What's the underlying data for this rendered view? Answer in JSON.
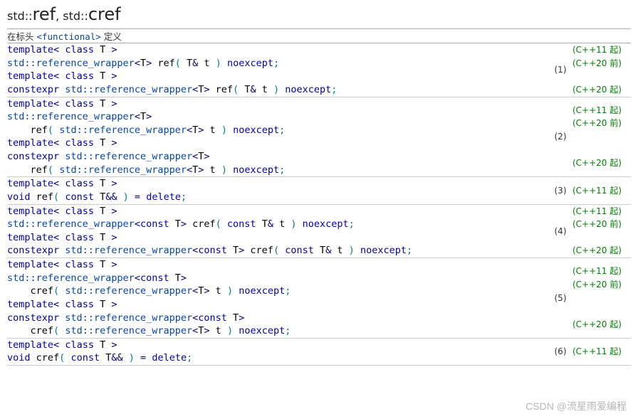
{
  "title": {
    "p1": "std::",
    "b1": "ref",
    "sep": ", ",
    "p2": "std::",
    "b2": "cref"
  },
  "header": {
    "pre": "在标头 ",
    "file": "<functional>",
    "post": " 定义"
  },
  "notes": {
    "s11": "(C++11 起)",
    "b20": "(C++20 前)",
    "s20": "(C++20 起)"
  },
  "nums": {
    "n1": "(1)",
    "n2": "(2)",
    "n3": "(3)",
    "n4": "(4)",
    "n5": "(5)",
    "n6": "(6)"
  },
  "chart_data": {
    "type": "table",
    "title": "std::ref, std::cref overloads",
    "header_note": "在标头 <functional> 定义",
    "overloads": [
      {
        "num": 1,
        "variants": [
          {
            "code": "template< class T >\nstd::reference_wrapper<T> ref( T& t ) noexcept;",
            "since": "C++11 起",
            "until": "C++20 前"
          },
          {
            "code": "template< class T >\nconstexpr std::reference_wrapper<T> ref( T& t ) noexcept;",
            "since": "C++20 起"
          }
        ]
      },
      {
        "num": 2,
        "variants": [
          {
            "code": "template< class T >\nstd::reference_wrapper<T>\n    ref( std::reference_wrapper<T> t ) noexcept;",
            "since": "C++11 起",
            "until": "C++20 前"
          },
          {
            "code": "template< class T >\nconstexpr std::reference_wrapper<T>\n    ref( std::reference_wrapper<T> t ) noexcept;",
            "since": "C++20 起"
          }
        ]
      },
      {
        "num": 3,
        "variants": [
          {
            "code": "template< class T >\nvoid ref( const T&& ) = delete;",
            "since": "C++11 起"
          }
        ]
      },
      {
        "num": 4,
        "variants": [
          {
            "code": "template< class T >\nstd::reference_wrapper<const T> cref( const T& t ) noexcept;",
            "since": "C++11 起",
            "until": "C++20 前"
          },
          {
            "code": "template< class T >\nconstexpr std::reference_wrapper<const T> cref( const T& t ) noexcept;",
            "since": "C++20 起"
          }
        ]
      },
      {
        "num": 5,
        "variants": [
          {
            "code": "template< class T >\nstd::reference_wrapper<const T>\n    cref( std::reference_wrapper<T> t ) noexcept;",
            "since": "C++11 起",
            "until": "C++20 前"
          },
          {
            "code": "template< class T >\nconstexpr std::reference_wrapper<const T>\n    cref( std::reference_wrapper<T> t ) noexcept;",
            "since": "C++20 起"
          }
        ]
      },
      {
        "num": 6,
        "variants": [
          {
            "code": "template< class T >\nvoid cref( const T&& ) = delete;",
            "since": "C++11 起"
          }
        ]
      }
    ]
  },
  "watermark": "CSDN @流星雨爱编程"
}
